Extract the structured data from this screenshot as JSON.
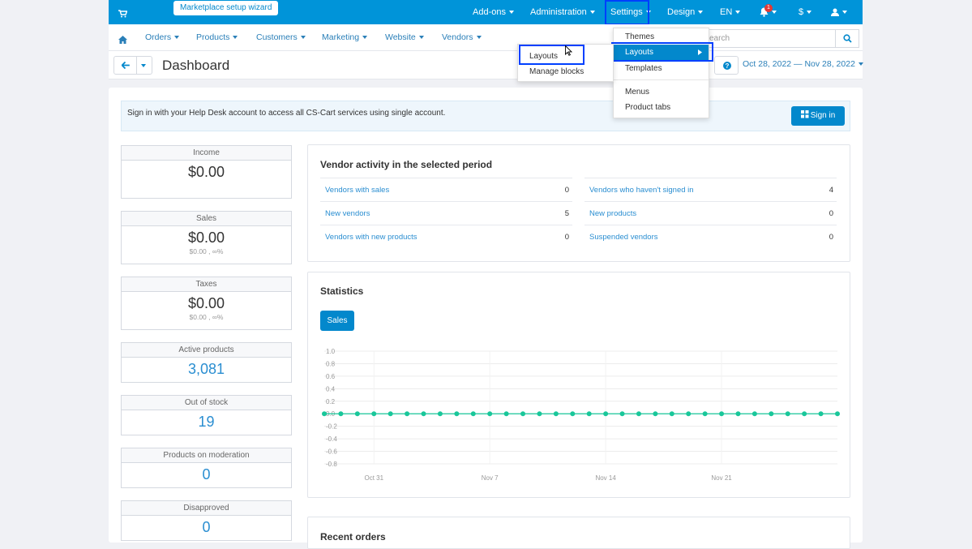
{
  "topbar": {
    "wizard": "Marketplace setup wizard",
    "addons": "Add-ons",
    "administration": "Administration",
    "settings": "Settings",
    "design": "Design",
    "language": "EN",
    "notifications_count": "1",
    "currency": "$"
  },
  "subnav": {
    "orders": "Orders",
    "products": "Products",
    "customers": "Customers",
    "marketing": "Marketing",
    "website": "Website",
    "vendors": "Vendors",
    "search_placeholder": "earch"
  },
  "page": {
    "title": "Dashboard",
    "date_range": "Oct 28, 2022 — Nov 28, 2022"
  },
  "helpdesk": {
    "text": "Sign in with your Help Desk account to access all CS-Cart services using single account.",
    "signin": "Sign in"
  },
  "stats": [
    {
      "label": "Income",
      "value": "$0.00",
      "sub": ""
    },
    {
      "label": "Sales",
      "value": "$0.00",
      "sub": "$0.00 , ∞%"
    },
    {
      "label": "Taxes",
      "value": "$0.00",
      "sub": "$0.00 , ∞%"
    },
    {
      "label": "Active products",
      "value": "3,081",
      "sub": ""
    },
    {
      "label": "Out of stock",
      "value": "19",
      "sub": ""
    },
    {
      "label": "Products on moderation",
      "value": "0",
      "sub": ""
    },
    {
      "label": "Disapproved",
      "value": "0",
      "sub": ""
    }
  ],
  "vendor_activity": {
    "title": "Vendor activity in the selected period",
    "left": [
      {
        "label": "Vendors with sales",
        "value": "0"
      },
      {
        "label": "New vendors",
        "value": "5"
      },
      {
        "label": "Vendors with new products",
        "value": "0"
      }
    ],
    "right": [
      {
        "label": "Vendors who haven't signed in",
        "value": "4"
      },
      {
        "label": "New products",
        "value": "0"
      },
      {
        "label": "Suspended vendors",
        "value": "0"
      }
    ]
  },
  "statistics": {
    "title": "Statistics",
    "tab": "Sales"
  },
  "recent_orders": {
    "title": "Recent orders"
  },
  "design_menu": {
    "items": [
      "Themes",
      "Layouts",
      "Templates",
      "Menus",
      "Product tabs"
    ],
    "active": "Layouts"
  },
  "layouts_submenu": {
    "items": [
      "Layouts",
      "Manage blocks"
    ]
  },
  "colors": {
    "topbar": "#0094d9",
    "accent": "#0388cc",
    "link": "#2a8ed1",
    "chart_point": "#19c79a",
    "highlight": "#0040ff"
  },
  "chart_data": {
    "type": "line",
    "title": "",
    "xlabel": "",
    "ylabel": "",
    "ylim": [
      -0.8,
      1.0
    ],
    "yticks": [
      "1.0",
      "0.8",
      "0.6",
      "0.4",
      "0.2",
      "0.0",
      "-0.2",
      "-0.4",
      "-0.6",
      "-0.8"
    ],
    "xticks": [
      "Oct 31",
      "Nov 7",
      "Nov 14",
      "Nov 21"
    ],
    "series": [
      {
        "values": [
          0,
          0,
          0,
          0,
          0,
          0,
          0,
          0,
          0,
          0,
          0,
          0,
          0,
          0,
          0,
          0,
          0,
          0,
          0,
          0,
          0,
          0,
          0,
          0,
          0,
          0,
          0,
          0,
          0,
          0,
          0,
          0
        ]
      }
    ],
    "grid": true
  }
}
